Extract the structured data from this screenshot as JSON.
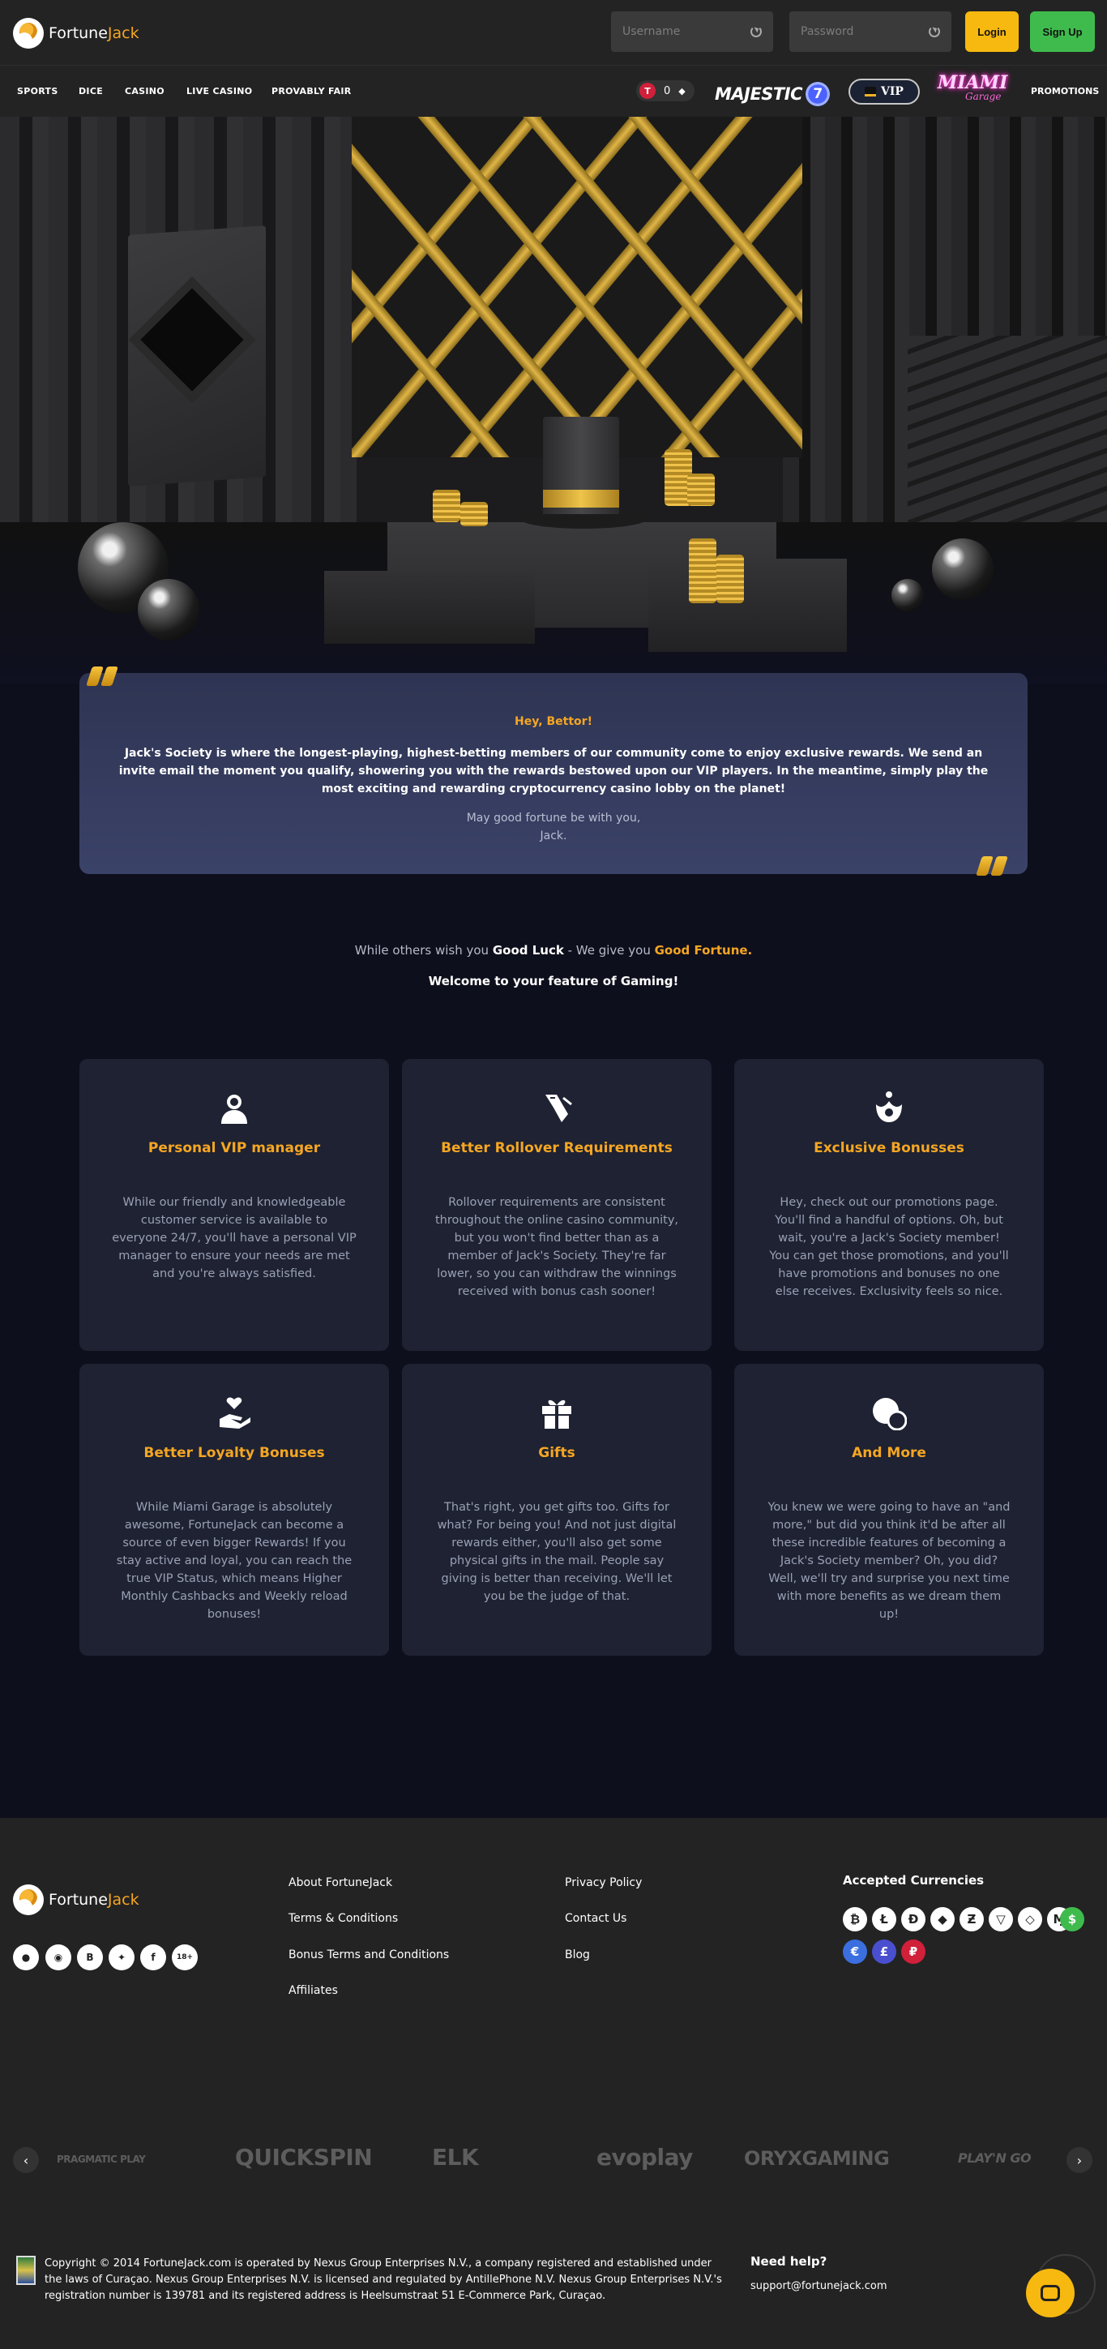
{
  "brand": {
    "name_part1": "Fortune",
    "name_part2": "Jack"
  },
  "header": {
    "username_placeholder": "Username",
    "password_placeholder": "Password",
    "login_label": "Login",
    "signup_label": "Sign Up"
  },
  "nav": {
    "items": [
      "SPORTS",
      "DICE",
      "CASINO",
      "LIVE CASINO",
      "PROVABLY FAIR"
    ],
    "coin_badge": "T",
    "coin_value": "0",
    "majestic_label": "MAJESTIC",
    "majestic_number": "7",
    "vip_label": "VIP",
    "miami_line1": "MIAMI",
    "miami_line2": "Garage",
    "promotions": "PROMOTIONS"
  },
  "quote": {
    "greeting": "Hey, Bettor!",
    "body": "Jack's Society is where the longest-playing, highest-betting members of our community come to enjoy exclusive rewards. We send an invite email the moment you qualify, showering you with the rewards bestowed upon our VIP players. In the meantime, simply play the most exciting and rewarding cryptocurrency casino lobby on the planet!",
    "sign_line1": "May good fortune be with you,",
    "sign_line2": "Jack."
  },
  "tagline": {
    "part1": "While others wish you ",
    "good_luck": "Good Luck",
    "part2": " - We give you ",
    "good_fortune": "Good Fortune.",
    "welcome": "Welcome to your feature of Gaming!"
  },
  "features": [
    {
      "icon": "vip-manager-icon",
      "title": "Personal VIP manager",
      "text": "While our friendly and knowledgeable customer service is available to everyone 24/7, you'll have a personal VIP manager to ensure your needs are met and you're always satisfied."
    },
    {
      "icon": "rollover-icon",
      "title": "Better Rollover Requirements",
      "text": "Rollover requirements are consistent throughout the online casino community, but you won't find better than as a member of Jack's Society. They're far lower, so you can withdraw the winnings received with bonus cash sooner!"
    },
    {
      "icon": "exclusive-bonus-icon",
      "title": "Exclusive Bonusses",
      "text": "Hey, check out our promotions page. You'll find a handful of options. Oh, but wait, you're a Jack's Society member! You can get those promotions, and you'll have promotions and bonuses no one else receives. Exclusivity feels so nice."
    },
    {
      "icon": "loyalty-icon",
      "title": "Better Loyalty Bonuses",
      "text": "While Miami Garage is absolutely awesome, FortuneJack can become a source of even bigger Rewards! If you stay active and loyal, you can reach the true VIP Status, which means Higher Monthly Cashbacks and Weekly reload bonuses!"
    },
    {
      "icon": "gift-icon",
      "title": "Gifts",
      "text": "That's right, you get gifts too. Gifts for what? For being you! And not just digital rewards either, you'll also get some physical gifts in the mail. People say giving is better than receiving. We'll let you be the judge of that."
    },
    {
      "icon": "more-icon",
      "title": "And More",
      "text": "You knew we were going to have an \"and more,\" but did you think it'd be after all these incredible features of becoming a Jack's Society member? Oh, you did? Well, we'll try and surprise you next time with more benefits as we dream them up!"
    }
  ],
  "footer": {
    "social": [
      "reddit-icon",
      "discord-icon",
      "bitcoin-talk-icon",
      "twitter-icon",
      "facebook-icon"
    ],
    "age_badge": "18+",
    "links_col1": [
      "About FortuneJack",
      "Terms & Conditions",
      "Bonus Terms and Conditions",
      "Affiliates"
    ],
    "links_col2": [
      "Privacy Policy",
      "Contact Us",
      "Blog"
    ],
    "currencies_title": "Accepted Currencies",
    "currencies_row1": [
      "₿",
      "Ł",
      "Ð",
      "◆",
      "Ƶ",
      "▽",
      "◇",
      "Ɱ",
      "$"
    ],
    "currencies_row2": [
      "€",
      "£",
      "₽"
    ],
    "providers": [
      "PRAGMATIC PLAY",
      "QUICKSPIN",
      "ELK",
      "evoplay",
      "ORYXGAMING",
      "PLAY'N GO"
    ],
    "copyright": "Copyright © 2014 FortuneJack.com is operated by Nexus Group Enterprises N.V., a company registered and established under the laws of Curaçao. Nexus Group Enterprises N.V. is licensed and regulated by AntillePhone N.V. Nexus Group Enterprises N.V.'s registration number is 139781 and its registered address is Heelsumstraat 51 E-Commerce Park, Curaçao.",
    "help_title": "Need help?",
    "help_email": "support@fortunejack.com"
  },
  "colors": {
    "accent": "#f5a623",
    "login": "#f7b90f",
    "signup": "#3fbb4d",
    "card": "#1e2232",
    "page": "#0e0f1c"
  }
}
